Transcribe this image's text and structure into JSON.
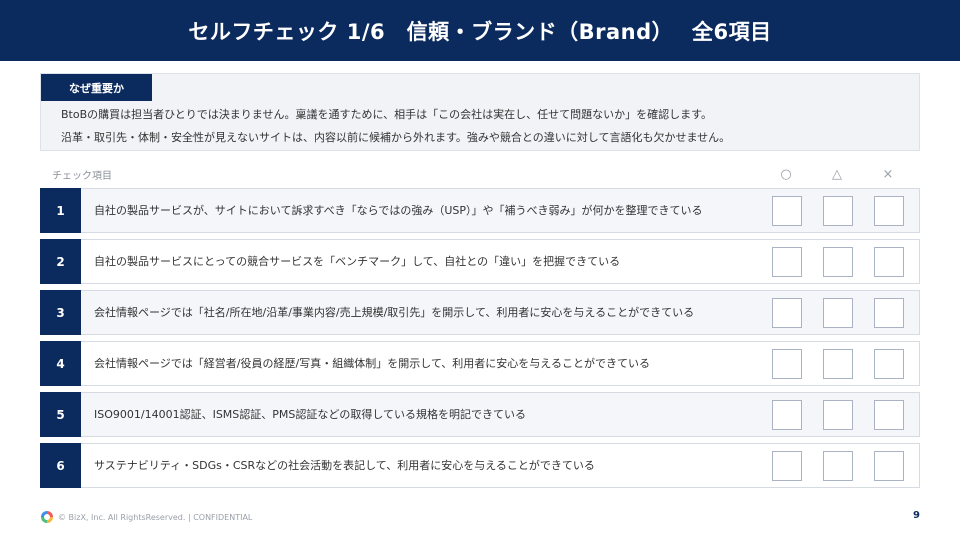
{
  "title": "セルフチェック 1/6　信頼・ブランド（Brand）　 全6項目",
  "why": {
    "label": "なぜ重要か",
    "line1": "BtoBの購買は担当者ひとりでは決まりません。稟議を通すために、相手は「この会社は実在し、任せて問題ないか」を確認します。",
    "line2": "沿革・取引先・体制・安全性が見えないサイトは、内容以前に候補から外れます。強みや競合との違いに対して言語化も欠かせません。"
  },
  "columns": {
    "check": "チェック項目",
    "ok": "○",
    "tri": "△",
    "ng": "×"
  },
  "items": [
    {
      "num": "1",
      "text": "自社の製品サービスが、サイトにおいて訴求すべき「ならではの強み（USP）」や「補うべき弱み」が何かを整理できている"
    },
    {
      "num": "2",
      "text": "自社の製品サービスにとっての競合サービスを「ベンチマーク」して、自社との「違い」を把握できている"
    },
    {
      "num": "3",
      "text": "会社情報ページでは「社名/所在地/沿革/事業内容/売上規模/取引先」を開示して、利用者に安心を与えることができている"
    },
    {
      "num": "4",
      "text": "会社情報ページでは「経営者/役員の経歴/写真・組織体制」を開示して、利用者に安心を与えることができている"
    },
    {
      "num": "5",
      "text": "ISO9001/14001認証、ISMS認証、PMS認証などの取得している規格を明記できている"
    },
    {
      "num": "6",
      "text": "サステナビリティ・SDGs・CSRなどの社会活動を表記して、利用者に安心を与えることができている"
    }
  ],
  "footer": {
    "copyright": "© BizX, Inc. All RightsReserved. | CONFIDENTIAL",
    "page": "9"
  },
  "colors": {
    "navy": "#0b2a5e",
    "panel": "#f1f3f6",
    "border": "#d6dbe3"
  }
}
